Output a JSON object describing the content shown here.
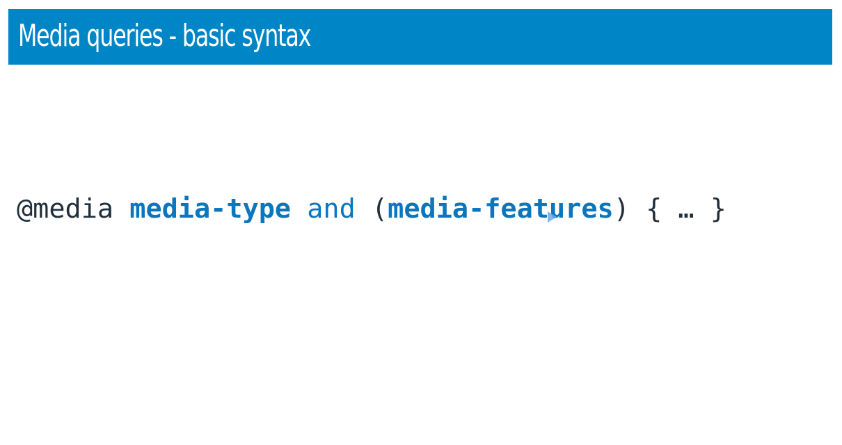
{
  "slide": {
    "title": "Media queries - basic syntax",
    "header_color": "#0086c6",
    "code": {
      "at_rule": "@media",
      "media_type": "media-type",
      "operator": "and",
      "open_paren": "(",
      "media_features": "media-features",
      "close_paren": ")",
      "block": "{ … }"
    },
    "colors": {
      "keyword": "#0a76bd",
      "default_text": "#212f3a"
    }
  }
}
